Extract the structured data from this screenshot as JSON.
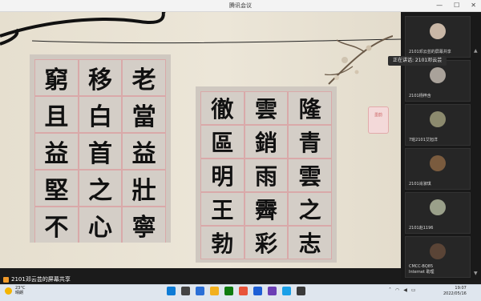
{
  "window": {
    "title": "腾讯会议",
    "minimize_icon": "minimize-icon",
    "maximize_icon": "maximize-icon",
    "close_icon": "close-icon"
  },
  "share": {
    "photo1_chars": [
      "窮",
      "移",
      "老",
      "且",
      "白",
      "當",
      "益",
      "首",
      "益",
      "堅",
      "之",
      "壯",
      "不",
      "心",
      "寧"
    ],
    "photo2_chars": [
      "徹",
      "雲",
      "隆",
      "區",
      "銷",
      "青",
      "明",
      "雨",
      "雲",
      "王",
      "霽",
      "之",
      "勃",
      "彩",
      "志"
    ],
    "stamp_text": "墨韵",
    "status_label": "2101邓云芸的屏幕共享"
  },
  "participants": [
    {
      "name": "2101邓云芸的屏幕共享",
      "avatar_color": "#c9b7a6"
    },
    {
      "name": "2101杨梓含",
      "avatar_color": "#a9a29a"
    },
    {
      "name": "7班2101艾旭洋",
      "avatar_color": "#8c8a6e"
    },
    {
      "name": "2101肖淑琪",
      "avatar_color": "#7a5b3e"
    },
    {
      "name": "2101赵1196",
      "avatar_color": "#9aa08a"
    },
    {
      "name": "CMCC-BQ85",
      "subname": "Internet 助理",
      "avatar_color": "#5a4436"
    }
  ],
  "speaking": {
    "text": "正在讲话: 2101邓云芸"
  },
  "taskbar": {
    "weather_temp": "23°C",
    "weather_desc": "晴朗",
    "time": "19:07",
    "date": "2022/05/16",
    "icon_colors": [
      "#0e7cd6",
      "#444",
      "#2b6fd6",
      "#f2b01e",
      "#0f7b0f",
      "#e8543a",
      "#1d5fd6",
      "#6b3fb5",
      "#1aa0e8",
      "#3a3a3a"
    ]
  }
}
